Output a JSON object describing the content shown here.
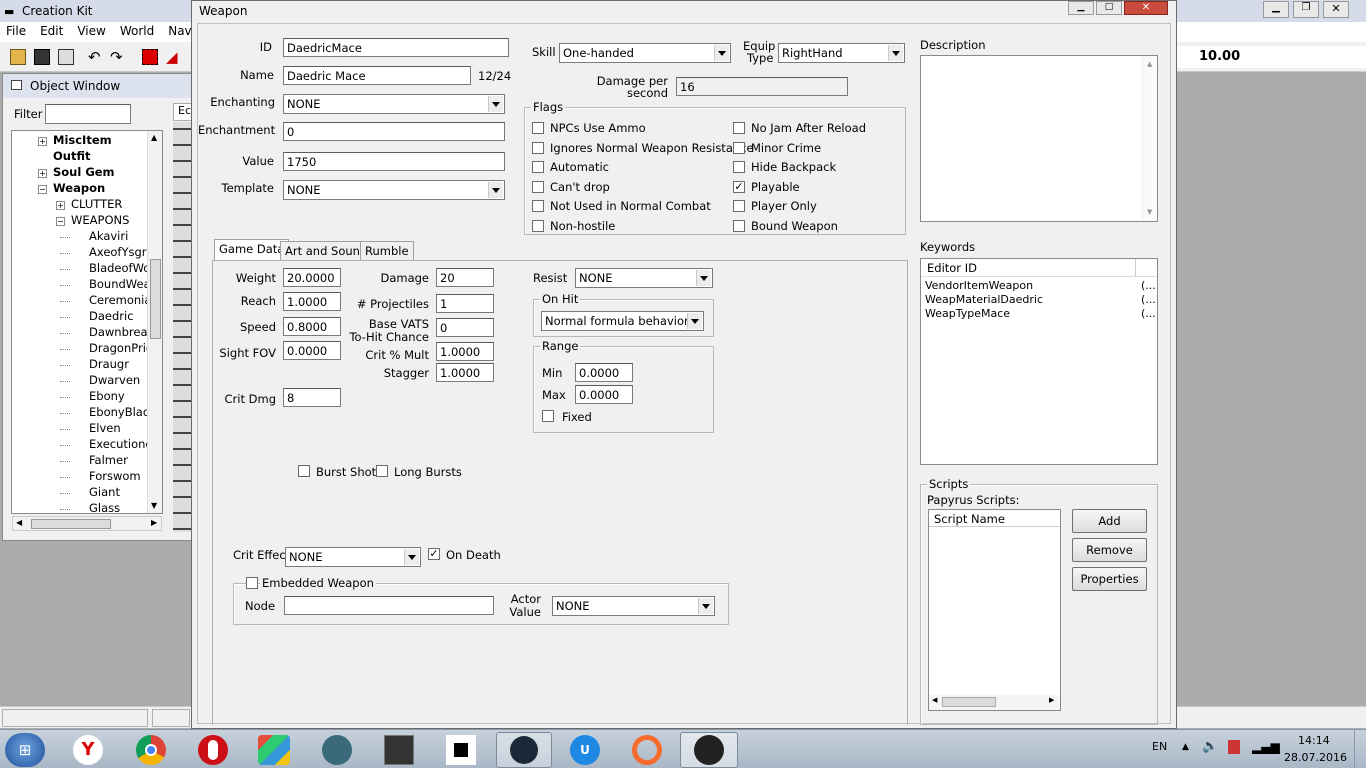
{
  "app": {
    "title": "Creation Kit",
    "menu": [
      "File",
      "Edit",
      "View",
      "World",
      "NavM"
    ],
    "right_value": "10.00"
  },
  "object_window": {
    "title": "Object Window",
    "filter_label": "Filter",
    "col_header": "Ec",
    "tree": [
      {
        "label": "MiscItem",
        "bold": true,
        "expander": "+",
        "indent": 0
      },
      {
        "label": "Outfit",
        "bold": true,
        "expander": "",
        "indent": 0
      },
      {
        "label": "Soul Gem",
        "bold": true,
        "expander": "+",
        "indent": 0
      },
      {
        "label": "Weapon",
        "bold": true,
        "expander": "-",
        "indent": 0
      },
      {
        "label": "CLUTTER",
        "bold": false,
        "expander": "+",
        "indent": 1
      },
      {
        "label": "WEAPONS",
        "bold": false,
        "expander": "-",
        "indent": 1
      },
      {
        "label": "Akaviri",
        "bold": false,
        "expander": "",
        "indent": 2
      },
      {
        "label": "AxeofYsgrar",
        "bold": false,
        "expander": "",
        "indent": 2
      },
      {
        "label": "BladeofWoe",
        "bold": false,
        "expander": "",
        "indent": 2
      },
      {
        "label": "BoundWeap",
        "bold": false,
        "expander": "",
        "indent": 2
      },
      {
        "label": "CeremonialE",
        "bold": false,
        "expander": "",
        "indent": 2
      },
      {
        "label": "Daedric",
        "bold": false,
        "expander": "",
        "indent": 2
      },
      {
        "label": "Dawnbreake",
        "bold": false,
        "expander": "",
        "indent": 2
      },
      {
        "label": "DragonPries",
        "bold": false,
        "expander": "",
        "indent": 2
      },
      {
        "label": "Draugr",
        "bold": false,
        "expander": "",
        "indent": 2
      },
      {
        "label": "Dwarven",
        "bold": false,
        "expander": "",
        "indent": 2
      },
      {
        "label": "Ebony",
        "bold": false,
        "expander": "",
        "indent": 2
      },
      {
        "label": "EbonyBlade",
        "bold": false,
        "expander": "",
        "indent": 2
      },
      {
        "label": "Elven",
        "bold": false,
        "expander": "",
        "indent": 2
      },
      {
        "label": "Executioner",
        "bold": false,
        "expander": "",
        "indent": 2
      },
      {
        "label": "Falmer",
        "bold": false,
        "expander": "",
        "indent": 2
      },
      {
        "label": "Forswom",
        "bold": false,
        "expander": "",
        "indent": 2
      },
      {
        "label": "Giant",
        "bold": false,
        "expander": "",
        "indent": 2
      },
      {
        "label": "Glass",
        "bold": false,
        "expander": "",
        "indent": 2
      }
    ]
  },
  "dialog": {
    "title": "Weapon",
    "id_label": "ID",
    "id_value": "DaedricMace",
    "name_label": "Name",
    "name_value": "Daedric Mace",
    "name_count": "12/24",
    "enchanting_label": "Enchanting",
    "enchanting_value": "NONE",
    "enchantment_label": "Enchantment",
    "enchantment_value": "0",
    "value_label": "Value",
    "value_value": "1750",
    "template_label": "Template",
    "template_value": "NONE",
    "skill_label": "Skill",
    "skill_value": "One-handed",
    "equip_label_1": "Equip",
    "equip_label_2": "Type",
    "equip_value": "RightHand",
    "dps_label_1": "Damage per",
    "dps_label_2": "second",
    "dps_value": "16",
    "flags_title": "Flags",
    "flags_left": [
      {
        "label": "NPCs Use Ammo",
        "checked": false
      },
      {
        "label": "Ignores Normal Weapon Resistance",
        "checked": false
      },
      {
        "label": "Automatic",
        "checked": false
      },
      {
        "label": "Can't drop",
        "checked": false
      },
      {
        "label": "Not Used in Normal Combat",
        "checked": false
      },
      {
        "label": "Non-hostile",
        "checked": false
      }
    ],
    "flags_right": [
      {
        "label": "No Jam After Reload",
        "checked": false
      },
      {
        "label": "Minor Crime",
        "checked": false
      },
      {
        "label": "Hide Backpack",
        "checked": false
      },
      {
        "label": "Playable",
        "checked": true
      },
      {
        "label": "Player Only",
        "checked": false
      },
      {
        "label": "Bound Weapon",
        "checked": false
      }
    ],
    "description_label": "Description",
    "keywords_label": "Keywords",
    "keywords_header": "Editor ID",
    "keywords": [
      {
        "id": "VendorItemWeapon",
        "extra": "(..."
      },
      {
        "id": "WeapMaterialDaedric",
        "extra": "(..."
      },
      {
        "id": "WeapTypeMace",
        "extra": "(..."
      }
    ],
    "tabs": [
      "Game Data",
      "Art and Sound",
      "Rumble"
    ],
    "weight_label": "Weight",
    "weight_value": "20.0000",
    "reach_label": "Reach",
    "reach_value": "1.0000",
    "speed_label": "Speed",
    "speed_value": "0.8000",
    "sightfov_label": "Sight FOV",
    "sightfov_value": "0.0000",
    "critdmg_label": "Crit Dmg",
    "critdmg_value": "8",
    "damage_label": "Damage",
    "damage_value": "20",
    "projectiles_label": "# Projectiles",
    "projectiles_value": "1",
    "vats_label_1": "Base VATS",
    "vats_label_2": "To-Hit Chance",
    "vats_value": "0",
    "critmult_label": "Crit % Mult",
    "critmult_value": "1.0000",
    "stagger_label": "Stagger",
    "stagger_value": "1.0000",
    "resist_label": "Resist",
    "resist_value": "NONE",
    "onhit_title": "On Hit",
    "onhit_value": "Normal formula behavior",
    "range_title": "Range",
    "min_label": "Min",
    "min_value": "0.0000",
    "max_label": "Max",
    "max_value": "0.0000",
    "fixed_label": "Fixed",
    "burst_label": "Burst Shot",
    "long_bursts_label": "Long Bursts",
    "crit_effect_label": "Crit Effect",
    "crit_effect_value": "NONE",
    "on_death_label": "On Death",
    "on_death_checked": true,
    "embedded_label": "Embedded Weapon",
    "node_label": "Node",
    "node_value": "",
    "actor_label_1": "Actor",
    "actor_label_2": "Value",
    "actor_value": "NONE",
    "scripts_title": "Scripts",
    "papyrus_label": "Papyrus Scripts:",
    "script_name_header": "Script Name",
    "add_label": "Add",
    "remove_label": "Remove",
    "properties_label": "Properties"
  },
  "taskbar": {
    "lang": "EN",
    "time": "14:14",
    "date": "28.07.2016"
  }
}
